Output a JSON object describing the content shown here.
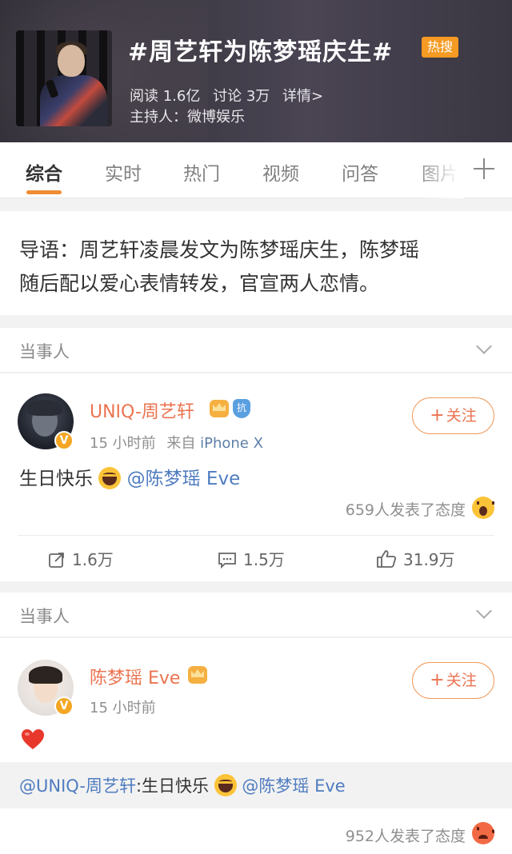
{
  "topic": {
    "title": "#周艺轩为陈梦瑶庆生#",
    "badge": "热搜",
    "reads": "阅读 1.6亿",
    "discussions": "讨论 3万",
    "details": "详情>",
    "host": "主持人：微博娱乐"
  },
  "tabs": [
    "综合",
    "实时",
    "热门",
    "视频",
    "问答",
    "图片"
  ],
  "intro": {
    "line1": "导语：周艺轩凌晨发文为陈梦瑶庆生，陈梦瑶",
    "line2": "随后配以爱心表情转发，官宣两人恋情。"
  },
  "section_label": "当事人",
  "posts": [
    {
      "username": "UNIQ-周艺轩",
      "shield_text": "抗",
      "verify_glyph": "V",
      "time": "15 小时前",
      "source_prefix": "来自",
      "source": "iPhone X",
      "follow_label": "关注",
      "content_text": "生日快乐",
      "mention": "@陈梦瑶 Eve",
      "reactions": "659人发表了态度",
      "reposts": "1.6万",
      "comments": "1.5万",
      "likes": "31.9万"
    },
    {
      "username": "陈梦瑶 Eve",
      "verify_glyph": "V",
      "time": "15 小时前",
      "follow_label": "关注",
      "repost_author": "@UNIQ-周艺轩",
      "repost_text": ":生日快乐",
      "repost_mention": "@陈梦瑶 Eve",
      "reactions": "952人发表了态度"
    }
  ],
  "colors": {
    "accent": "#eb7350",
    "link": "#4f7cc0",
    "badge": "#f59a23",
    "tab_indicator": "#f08c34"
  }
}
